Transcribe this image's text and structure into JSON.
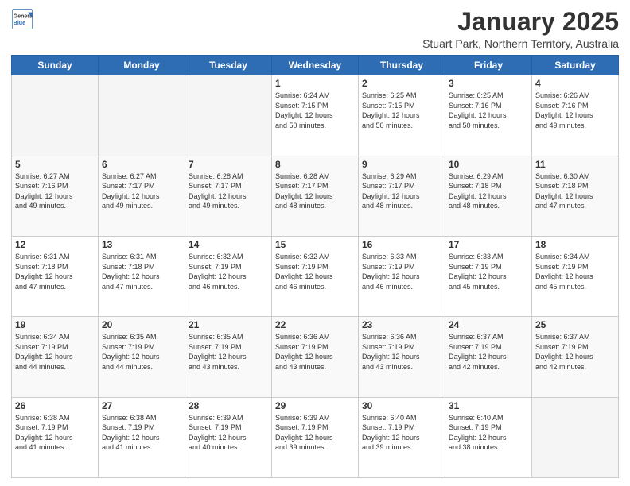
{
  "logo": {
    "general": "General",
    "blue": "Blue"
  },
  "header": {
    "month": "January 2025",
    "location": "Stuart Park, Northern Territory, Australia"
  },
  "weekdays": [
    "Sunday",
    "Monday",
    "Tuesday",
    "Wednesday",
    "Thursday",
    "Friday",
    "Saturday"
  ],
  "weeks": [
    [
      {
        "day": "",
        "empty": true
      },
      {
        "day": "",
        "empty": true
      },
      {
        "day": "",
        "empty": true
      },
      {
        "day": "1",
        "sunrise": "6:24 AM",
        "sunset": "7:15 PM",
        "daylight": "12 hours and 50 minutes."
      },
      {
        "day": "2",
        "sunrise": "6:25 AM",
        "sunset": "7:15 PM",
        "daylight": "12 hours and 50 minutes."
      },
      {
        "day": "3",
        "sunrise": "6:25 AM",
        "sunset": "7:16 PM",
        "daylight": "12 hours and 50 minutes."
      },
      {
        "day": "4",
        "sunrise": "6:26 AM",
        "sunset": "7:16 PM",
        "daylight": "12 hours and 49 minutes."
      }
    ],
    [
      {
        "day": "5",
        "sunrise": "6:27 AM",
        "sunset": "7:16 PM",
        "daylight": "12 hours and 49 minutes."
      },
      {
        "day": "6",
        "sunrise": "6:27 AM",
        "sunset": "7:17 PM",
        "daylight": "12 hours and 49 minutes."
      },
      {
        "day": "7",
        "sunrise": "6:28 AM",
        "sunset": "7:17 PM",
        "daylight": "12 hours and 49 minutes."
      },
      {
        "day": "8",
        "sunrise": "6:28 AM",
        "sunset": "7:17 PM",
        "daylight": "12 hours and 48 minutes."
      },
      {
        "day": "9",
        "sunrise": "6:29 AM",
        "sunset": "7:17 PM",
        "daylight": "12 hours and 48 minutes."
      },
      {
        "day": "10",
        "sunrise": "6:29 AM",
        "sunset": "7:18 PM",
        "daylight": "12 hours and 48 minutes."
      },
      {
        "day": "11",
        "sunrise": "6:30 AM",
        "sunset": "7:18 PM",
        "daylight": "12 hours and 47 minutes."
      }
    ],
    [
      {
        "day": "12",
        "sunrise": "6:31 AM",
        "sunset": "7:18 PM",
        "daylight": "12 hours and 47 minutes."
      },
      {
        "day": "13",
        "sunrise": "6:31 AM",
        "sunset": "7:18 PM",
        "daylight": "12 hours and 47 minutes."
      },
      {
        "day": "14",
        "sunrise": "6:32 AM",
        "sunset": "7:19 PM",
        "daylight": "12 hours and 46 minutes."
      },
      {
        "day": "15",
        "sunrise": "6:32 AM",
        "sunset": "7:19 PM",
        "daylight": "12 hours and 46 minutes."
      },
      {
        "day": "16",
        "sunrise": "6:33 AM",
        "sunset": "7:19 PM",
        "daylight": "12 hours and 46 minutes."
      },
      {
        "day": "17",
        "sunrise": "6:33 AM",
        "sunset": "7:19 PM",
        "daylight": "12 hours and 45 minutes."
      },
      {
        "day": "18",
        "sunrise": "6:34 AM",
        "sunset": "7:19 PM",
        "daylight": "12 hours and 45 minutes."
      }
    ],
    [
      {
        "day": "19",
        "sunrise": "6:34 AM",
        "sunset": "7:19 PM",
        "daylight": "12 hours and 44 minutes."
      },
      {
        "day": "20",
        "sunrise": "6:35 AM",
        "sunset": "7:19 PM",
        "daylight": "12 hours and 44 minutes."
      },
      {
        "day": "21",
        "sunrise": "6:35 AM",
        "sunset": "7:19 PM",
        "daylight": "12 hours and 43 minutes."
      },
      {
        "day": "22",
        "sunrise": "6:36 AM",
        "sunset": "7:19 PM",
        "daylight": "12 hours and 43 minutes."
      },
      {
        "day": "23",
        "sunrise": "6:36 AM",
        "sunset": "7:19 PM",
        "daylight": "12 hours and 43 minutes."
      },
      {
        "day": "24",
        "sunrise": "6:37 AM",
        "sunset": "7:19 PM",
        "daylight": "12 hours and 42 minutes."
      },
      {
        "day": "25",
        "sunrise": "6:37 AM",
        "sunset": "7:19 PM",
        "daylight": "12 hours and 42 minutes."
      }
    ],
    [
      {
        "day": "26",
        "sunrise": "6:38 AM",
        "sunset": "7:19 PM",
        "daylight": "12 hours and 41 minutes."
      },
      {
        "day": "27",
        "sunrise": "6:38 AM",
        "sunset": "7:19 PM",
        "daylight": "12 hours and 41 minutes."
      },
      {
        "day": "28",
        "sunrise": "6:39 AM",
        "sunset": "7:19 PM",
        "daylight": "12 hours and 40 minutes."
      },
      {
        "day": "29",
        "sunrise": "6:39 AM",
        "sunset": "7:19 PM",
        "daylight": "12 hours and 39 minutes."
      },
      {
        "day": "30",
        "sunrise": "6:40 AM",
        "sunset": "7:19 PM",
        "daylight": "12 hours and 39 minutes."
      },
      {
        "day": "31",
        "sunrise": "6:40 AM",
        "sunset": "7:19 PM",
        "daylight": "12 hours and 38 minutes."
      },
      {
        "day": "",
        "empty": true
      }
    ]
  ],
  "labels": {
    "sunrise": "Sunrise:",
    "sunset": "Sunset:",
    "daylight": "Daylight:"
  }
}
